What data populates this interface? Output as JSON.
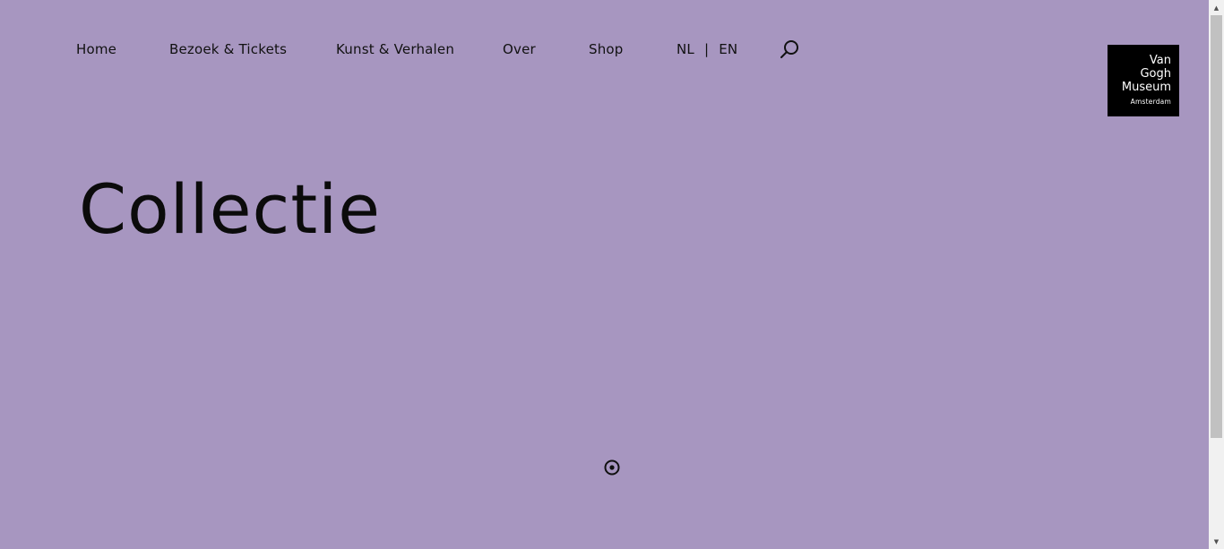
{
  "nav": {
    "items": [
      {
        "label": "Home"
      },
      {
        "label": "Bezoek & Tickets"
      },
      {
        "label": "Kunst & Verhalen"
      },
      {
        "label": "Over"
      },
      {
        "label": "Shop"
      }
    ],
    "lang": {
      "nl": "NL",
      "separator": "|",
      "en": "EN"
    },
    "search_icon": "search-icon"
  },
  "logo": {
    "line1": "Van",
    "line2": "Gogh",
    "line3": "Museum",
    "city": "Amsterdam"
  },
  "main": {
    "title": "Collectie",
    "scroll_icon": "scroll-down-indicator-icon"
  },
  "colors": {
    "background": "#a796c0",
    "text": "#111111",
    "logo_bg": "#000000",
    "logo_text": "#ffffff"
  }
}
